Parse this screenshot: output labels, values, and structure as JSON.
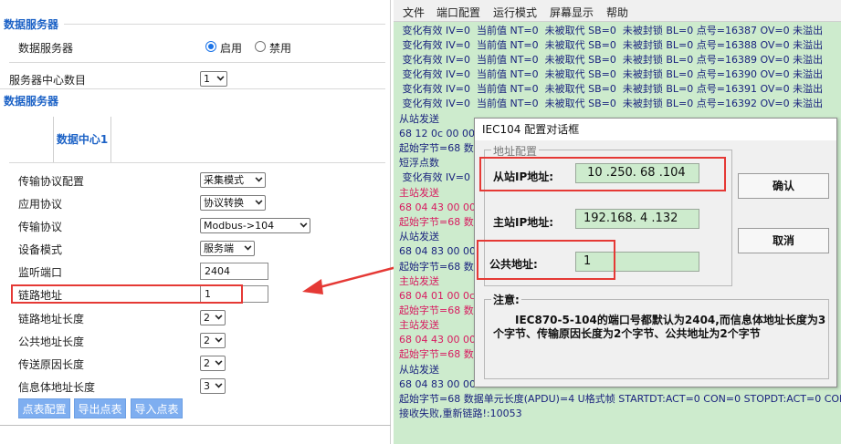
{
  "left": {
    "section1_title": "数据服务器",
    "data_server_label": "数据服务器",
    "radio_enable_label": "启用",
    "radio_disable_label": "禁用",
    "center_count_label": "服务器中心数目",
    "center_count_value": "1",
    "section2_title": "数据服务器",
    "tab_label": "数据中心1",
    "rows": [
      {
        "label": "传输协议配置",
        "value": "采集模式"
      },
      {
        "label": "应用协议",
        "value": "协议转换"
      },
      {
        "label": "传输协议",
        "value": "Modbus->104"
      },
      {
        "label": "设备模式",
        "value": "服务端"
      },
      {
        "label": "监听端口",
        "value": "2404"
      },
      {
        "label": "链路地址",
        "value": "1"
      },
      {
        "label": "链路地址长度",
        "value": "2"
      },
      {
        "label": "公共地址长度",
        "value": "2"
      },
      {
        "label": "传送原因长度",
        "value": "2"
      },
      {
        "label": "信息体地址长度",
        "value": "3"
      }
    ],
    "buttons": [
      "点表配置",
      "导出点表",
      "导入点表"
    ]
  },
  "app": {
    "menu": [
      "文件",
      "端口配置",
      "运行模式",
      "屏幕显示",
      "帮助"
    ],
    "log_lines": [
      {
        "text": " 变化有效 IV=0  当前值 NT=0  未被取代 SB=0  未被封锁 BL=0 点号=16387 OV=0 未溢出",
        "red": false
      },
      {
        "text": " 变化有效 IV=0  当前值 NT=0  未被取代 SB=0  未被封锁 BL=0 点号=16388 OV=0 未溢出",
        "red": false
      },
      {
        "text": " 变化有效 IV=0  当前值 NT=0  未被取代 SB=0  未被封锁 BL=0 点号=16389 OV=0 未溢出",
        "red": false
      },
      {
        "text": " 变化有效 IV=0  当前值 NT=0  未被取代 SB=0  未被封锁 BL=0 点号=16390 OV=0 未溢出",
        "red": false
      },
      {
        "text": " 变化有效 IV=0  当前值 NT=0  未被取代 SB=0  未被封锁 BL=0 点号=16391 OV=0 未溢出",
        "red": false
      },
      {
        "text": " 变化有效 IV=0  当前值 NT=0  未被取代 SB=0  未被封锁 BL=0 点号=16392 OV=0 未溢出",
        "red": false
      },
      {
        "text": "从站发送",
        "red": false
      },
      {
        "text": "68 12 0c 00 00",
        "red": false
      },
      {
        "text": "起始字节=68 数",
        "red": false
      },
      {
        "text": "短浮点数",
        "red": false
      },
      {
        "text": " 变化有效 IV=0",
        "red": false
      },
      {
        "text": "主站发送",
        "red": true
      },
      {
        "text": "68 04 43 00 00",
        "red": true
      },
      {
        "text": "起始字节=68 数",
        "red": true
      },
      {
        "text": "从站发送",
        "red": false
      },
      {
        "text": "68 04 83 00 00",
        "red": false
      },
      {
        "text": "起始字节=68 数",
        "red": false
      },
      {
        "text": "主站发送",
        "red": true
      },
      {
        "text": "68 04 01 00 0c",
        "red": true
      },
      {
        "text": "起始字节=68 数",
        "red": true
      },
      {
        "text": "主站发送",
        "red": true
      },
      {
        "text": "68 04 43 00 00",
        "red": true
      },
      {
        "text": "起始字节=68 数",
        "red": true
      },
      {
        "text": "从站发送",
        "red": false
      },
      {
        "text": "68 04 83 00 00",
        "red": false
      },
      {
        "text": "起始字节=68 数据单元长度(APDU)=4 U格式帧 STARTDT:ACT=0 CON=0 STOPDT:ACT=0 CON=0 T",
        "red": false
      },
      {
        "text": "接收失败,重新链路!:10053",
        "red": false
      }
    ]
  },
  "dialog": {
    "title": "IEC104 配置对话框",
    "group_label": "地址配置",
    "slave_ip_label": "从站IP地址:",
    "slave_ip_value": " 10 .250. 68 .104",
    "master_ip_label": "主站IP地址:",
    "master_ip_value": "192.168. 4 .132",
    "common_addr_label": "公共地址:",
    "common_addr_value": "1",
    "ok_label": "确认",
    "cancel_label": "取消",
    "note_title": "注意:",
    "note_text": "IEC870-5-104的端口号都默认为2404,而信息体地址长度为3个字节、传输原因长度为2个字节、公共地址为2个字节"
  },
  "colors": {
    "accent_blue": "#1c62c6",
    "highlight_red": "#e53935",
    "log_bg": "#cdebcd"
  }
}
